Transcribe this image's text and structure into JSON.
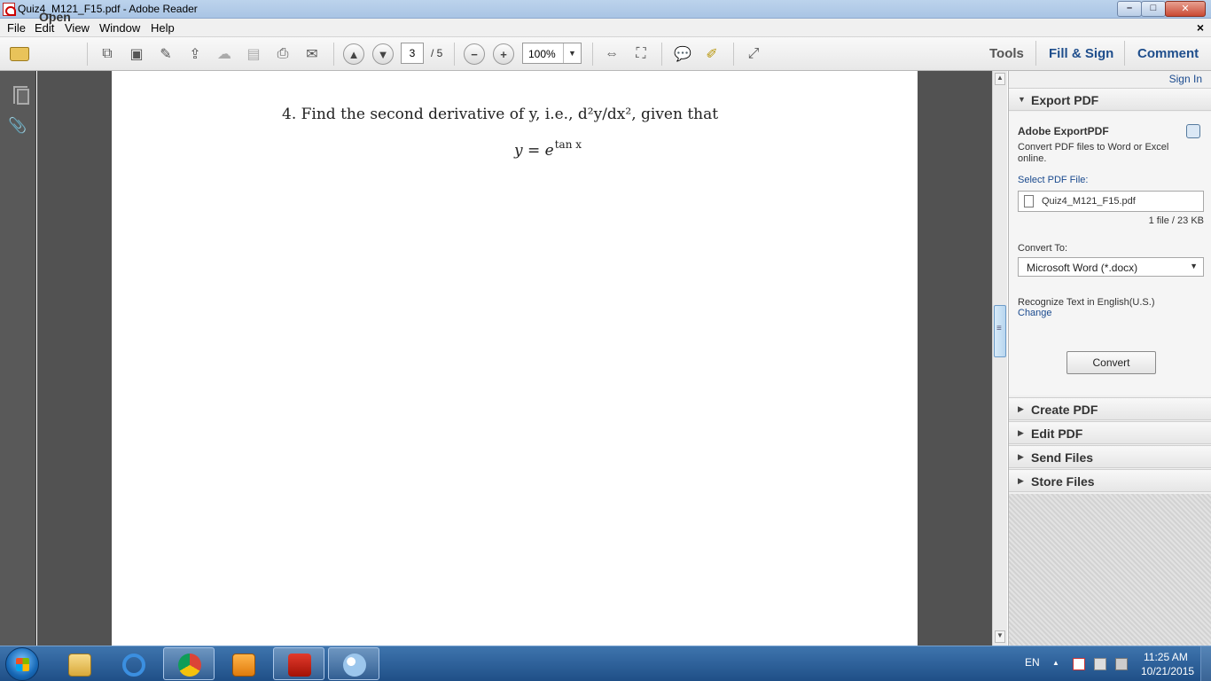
{
  "window": {
    "title": "Quiz4_M121_F15.pdf - Adobe Reader",
    "minimize_glyph": "–",
    "maximize_glyph": "□",
    "close_glyph": "✕"
  },
  "menubar": {
    "items": [
      "File",
      "Edit",
      "View",
      "Window",
      "Help"
    ],
    "doc_close": "×"
  },
  "toolbar": {
    "open_label": "Open",
    "page_current": "3",
    "page_total": "/ 5",
    "zoom": "100%",
    "tools_label": "Tools",
    "fill_sign_label": "Fill & Sign",
    "comment_label": "Comment",
    "accent_color": "#1f4e8c"
  },
  "document": {
    "question": "4.  Find the second derivative of y, i.e., d²y/dx², given that",
    "equation_base": "y = e",
    "equation_exponent": "tan x"
  },
  "rightpane": {
    "sign_in": "Sign In",
    "export_pdf": {
      "header": "Export PDF",
      "service_title": "Adobe ExportPDF",
      "description_line1": "Convert PDF files to Word or Excel",
      "description_line2": "online.",
      "select_label": "Select PDF File:",
      "file_name": "Quiz4_M121_F15.pdf",
      "file_info": "1 file / 23 KB",
      "convert_to_label": "Convert To:",
      "convert_to_value": "Microsoft Word (*.docx)",
      "recognize_text": "Recognize Text in English(U.S.)",
      "change_link": "Change",
      "convert_button": "Convert"
    },
    "panels": [
      "Create PDF",
      "Edit PDF",
      "Send Files",
      "Store Files"
    ]
  },
  "taskbar": {
    "language": "EN",
    "time": "11:25 AM",
    "date": "10/21/2015",
    "tray_expand": "▲"
  }
}
